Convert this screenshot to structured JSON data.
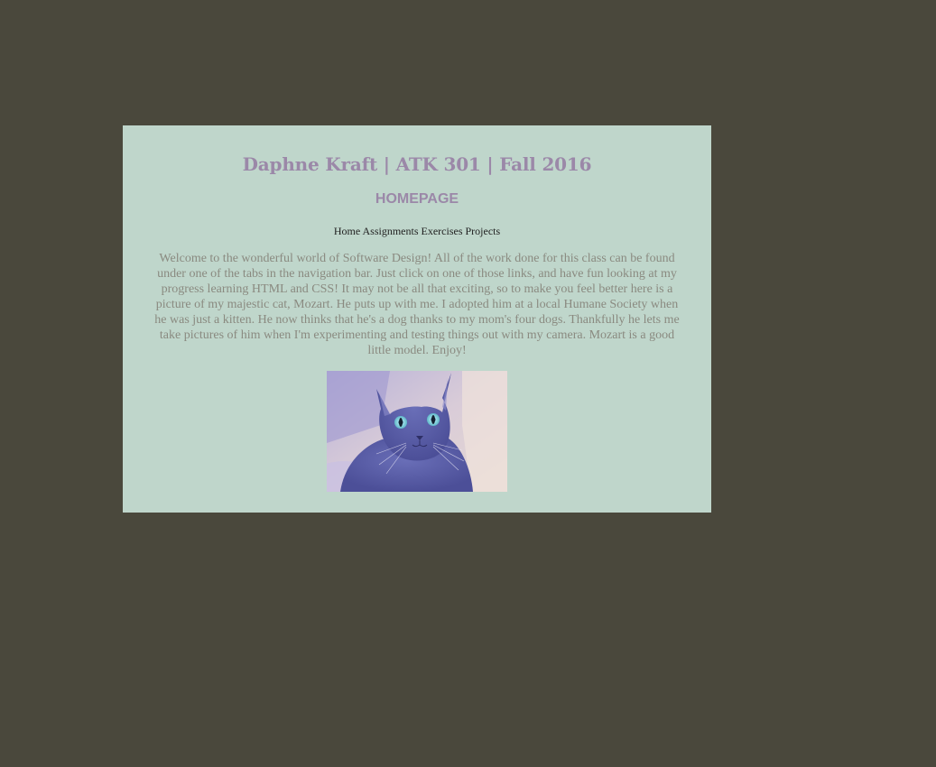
{
  "header": {
    "title": "Daphne Kraft | ATK 301 | Fall 2016",
    "subtitle": "HOMEPAGE"
  },
  "nav": {
    "items": [
      {
        "label": "Home"
      },
      {
        "label": "Assignments"
      },
      {
        "label": "Exercises"
      },
      {
        "label": "Projects"
      }
    ]
  },
  "main": {
    "intro": "Welcome to the wonderful world of Software Design! All of the work done for this class can be found under one of the tabs in the navigation bar. Just click on one of those links, and have fun looking at my progress learning HTML and CSS! It may not be all that exciting, so to make you feel better here is a picture of my majestic cat, Mozart. He puts up with me. I adopted him at a local Humane Society when he was just a kitten. He now thinks that he's a dog thanks to my mom's four dogs. Thankfully he lets me take pictures of him when I'm experimenting and testing things out with my camera. Mozart is a good little model. Enjoy!"
  },
  "colors": {
    "page_background": "#4a483c",
    "card_background": "#bfd6cb",
    "heading": "#9b88a8",
    "body_text": "#8a8a80"
  }
}
